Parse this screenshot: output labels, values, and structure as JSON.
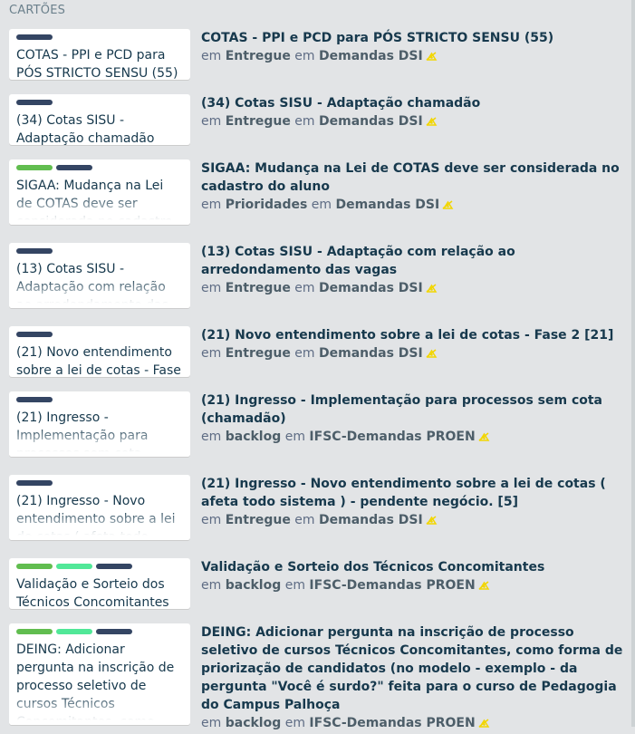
{
  "section_title": "CARTÕES",
  "colors": {
    "dark_label": "#344563",
    "green_label": "#61bd4f",
    "mint_label": "#51e898",
    "watch_icon": "#f2d600"
  },
  "connector_in": "em",
  "results": [
    {
      "mini_title": "COTAS - PPI e PCD para PÓS STRICTO SENSU (55)",
      "labels": [
        "dark"
      ],
      "name": "COTAS - PPI e PCD para PÓS STRICTO SENSU (55)",
      "list": "Entregue",
      "board": "Demandas DSI"
    },
    {
      "mini_title": "(34) Cotas SISU - Adaptação chamadão",
      "labels": [
        "dark"
      ],
      "name": "(34) Cotas SISU - Adaptação chamadão",
      "list": "Entregue",
      "board": "Demandas DSI"
    },
    {
      "mini_title": "SIGAA: Mudança na Lei de COTAS deve ser considerada no cadastro do aluno",
      "labels": [
        "green",
        "dark"
      ],
      "name": "SIGAA: Mudança na Lei de COTAS deve ser considerada no cadastro do aluno",
      "list": "Prioridades",
      "board": "Demandas DSI"
    },
    {
      "mini_title": "(13) Cotas SISU - Adaptação com relação ao arredondamento das vagas",
      "labels": [
        "dark"
      ],
      "name": "(13) Cotas SISU - Adaptação com relação ao arredondamento das vagas",
      "list": "Entregue",
      "board": "Demandas DSI"
    },
    {
      "mini_title": "(21) Novo entendimento sobre a lei de cotas - Fase 2 [21]",
      "labels": [
        "dark"
      ],
      "name": "(21) Novo entendimento sobre a lei de cotas - Fase 2 [21]",
      "list": "Entregue",
      "board": "Demandas DSI"
    },
    {
      "mini_title": "(21) Ingresso - Implementação para processos sem cota (chamadão)",
      "labels": [
        "dark"
      ],
      "name": "(21) Ingresso - Implementação para processos sem cota (chamadão)",
      "list": "backlog",
      "board": "IFSC-Demandas PROEN"
    },
    {
      "mini_title": "(21) Ingresso - Novo entendimento sobre a lei de cotas ( afeta todo sistema ) - pendente negócio. [5]",
      "labels": [
        "dark"
      ],
      "name": "(21) Ingresso - Novo entendimento sobre a lei de cotas ( afeta todo sistema ) - pendente negócio. [5]",
      "list": "Entregue",
      "board": "Demandas DSI"
    },
    {
      "mini_title": "Validação e Sorteio dos Técnicos Concomitantes",
      "labels": [
        "green",
        "mint",
        "dark"
      ],
      "name": "Validação e Sorteio dos Técnicos Concomitantes",
      "list": "backlog",
      "board": "IFSC-Demandas PROEN"
    },
    {
      "mini_title": "DEING: Adicionar pergunta na inscrição de processo seletivo de cursos Técnicos Concomitantes, como forma de priorização de candidatos",
      "labels": [
        "green",
        "mint",
        "dark"
      ],
      "name": "DEING: Adicionar pergunta na inscrição de processo seletivo de cursos Técnicos Concomitantes, como forma de priorização de candidatos (no modelo - exemplo - da pergunta \"Você é surdo?\" feita para o curso de Pedagogia do Campus Palhoça",
      "list": "backlog",
      "board": "IFSC-Demandas PROEN"
    }
  ]
}
